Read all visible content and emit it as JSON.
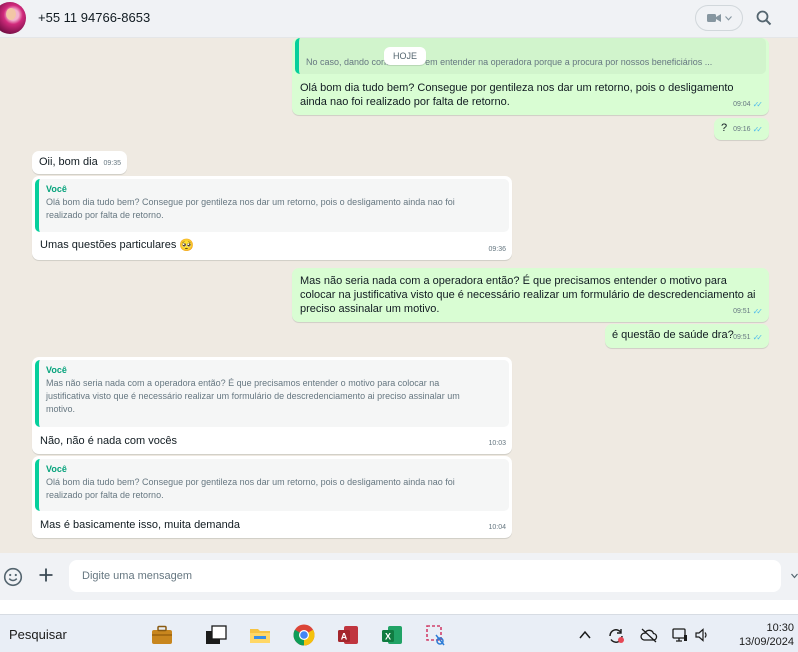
{
  "header": {
    "contact_name": "+55 11 94766-8653"
  },
  "chat": {
    "day_chip": "HOJE",
    "messages": [
      {
        "direction": "out",
        "quote_text": "No caso, dando continuidade em entender na operadora porque a procura por nossos beneficiários ...",
        "text": "Olá bom dia tudo bem? Consegue por gentileza nos dar um retorno, pois o desligamento ainda nao foi realizado por falta de retorno.",
        "time": "09:04",
        "read": true
      },
      {
        "direction": "out",
        "text": "?",
        "time": "09:16",
        "read": true
      },
      {
        "direction": "in",
        "text": "Oii, bom dia",
        "time": "09:35"
      },
      {
        "direction": "in",
        "quote_author": "Você",
        "quote_text": "Olá bom dia tudo bem? Consegue por gentileza nos dar um retorno, pois o desligamento ainda nao foi realizado por falta de retorno.",
        "text": "Umas questões particulares",
        "emoji": "🥺",
        "time": "09:36"
      },
      {
        "direction": "out",
        "text": "Mas não seria nada com a operadora então? É que precisamos entender o motivo para colocar na justificativa visto que é necessário realizar um formulário de descredenciamento ai preciso assinalar um motivo.",
        "time": "09:51",
        "read": true
      },
      {
        "direction": "out",
        "text": "é questão de saúde dra?",
        "time": "09:51",
        "read": true
      },
      {
        "direction": "in",
        "quote_author": "Você",
        "quote_text": "Mas não seria nada com a operadora então? É que precisamos entender o motivo para colocar na justificativa visto que é necessário realizar um formulário de descredenciamento ai preciso assinalar um motivo.",
        "text": "Não, não é nada com vocês",
        "time": "10:03"
      },
      {
        "direction": "in",
        "quote_author": "Você",
        "quote_text": "Olá bom dia tudo bem? Consegue por gentileza nos dar um retorno, pois o desligamento ainda nao foi realizado por falta de retorno.",
        "text": "Mas é basicamente isso, muita demanda",
        "time": "10:04"
      }
    ]
  },
  "composer": {
    "placeholder": "Digite uma mensagem"
  },
  "taskbar": {
    "search_label": "Pesquisar",
    "time": "10:30",
    "date": "13/09/2024"
  },
  "colors": {
    "outgoing_bubble": "#d9fdd3",
    "incoming_bubble": "#ffffff",
    "quote_accent": "#06cf9c",
    "read_ticks": "#53bdeb",
    "chat_background": "#efeae2"
  }
}
